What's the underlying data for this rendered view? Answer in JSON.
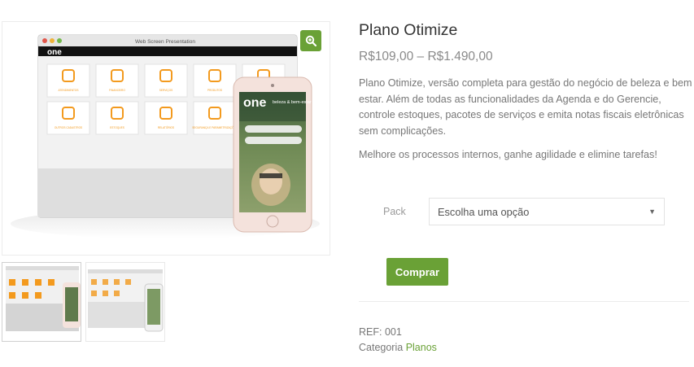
{
  "product": {
    "title": "Plano Otimize",
    "price_range": "R$109,00 – R$1.490,00",
    "description_1": "Plano Otimize, versão completa para gestão do negócio de beleza e bem estar. Além de todas as funcionalidades da Agenda e do Gerencie, controle estoques, pacotes de serviços e emita notas fiscais eletrônicas sem complicações.",
    "description_2": "Melhore os processos internos, ganhe agilidade e elimine tarefas!"
  },
  "image": {
    "window_title": "Web Screen Presentation",
    "app_logo": "one",
    "phone_logo": "one",
    "phone_tagline": "beleza & bem-estar",
    "tiles": [
      {
        "label": "ATENDIMENTOS",
        "icon": "headset-icon"
      },
      {
        "label": "FINANCEIRO",
        "icon": "money-icon"
      },
      {
        "label": "SERVIÇOS",
        "icon": "hairdryer-icon"
      },
      {
        "label": "PRODUTOS",
        "icon": "bottle-icon"
      },
      {
        "label": "",
        "icon": "truck-icon"
      },
      {
        "label": "OUTROS CADASTROS",
        "icon": "document-icon"
      },
      {
        "label": "ESTOQUES",
        "icon": "grid-icon"
      },
      {
        "label": "RELATÓRIOS",
        "icon": "chart-icon"
      },
      {
        "label": "SEGURANÇA E PARAMETRIZAÇÕES",
        "icon": "sliders-icon"
      }
    ]
  },
  "options": {
    "pack_label": "Pack",
    "select_value": "Escolha uma opção"
  },
  "buy_label": "Comprar",
  "meta": {
    "ref": "REF: 001",
    "category_label": "Categoria",
    "category_link": "Planos"
  },
  "colors": {
    "accent": "#6aa136",
    "tile_icon": "#f39a1e"
  }
}
